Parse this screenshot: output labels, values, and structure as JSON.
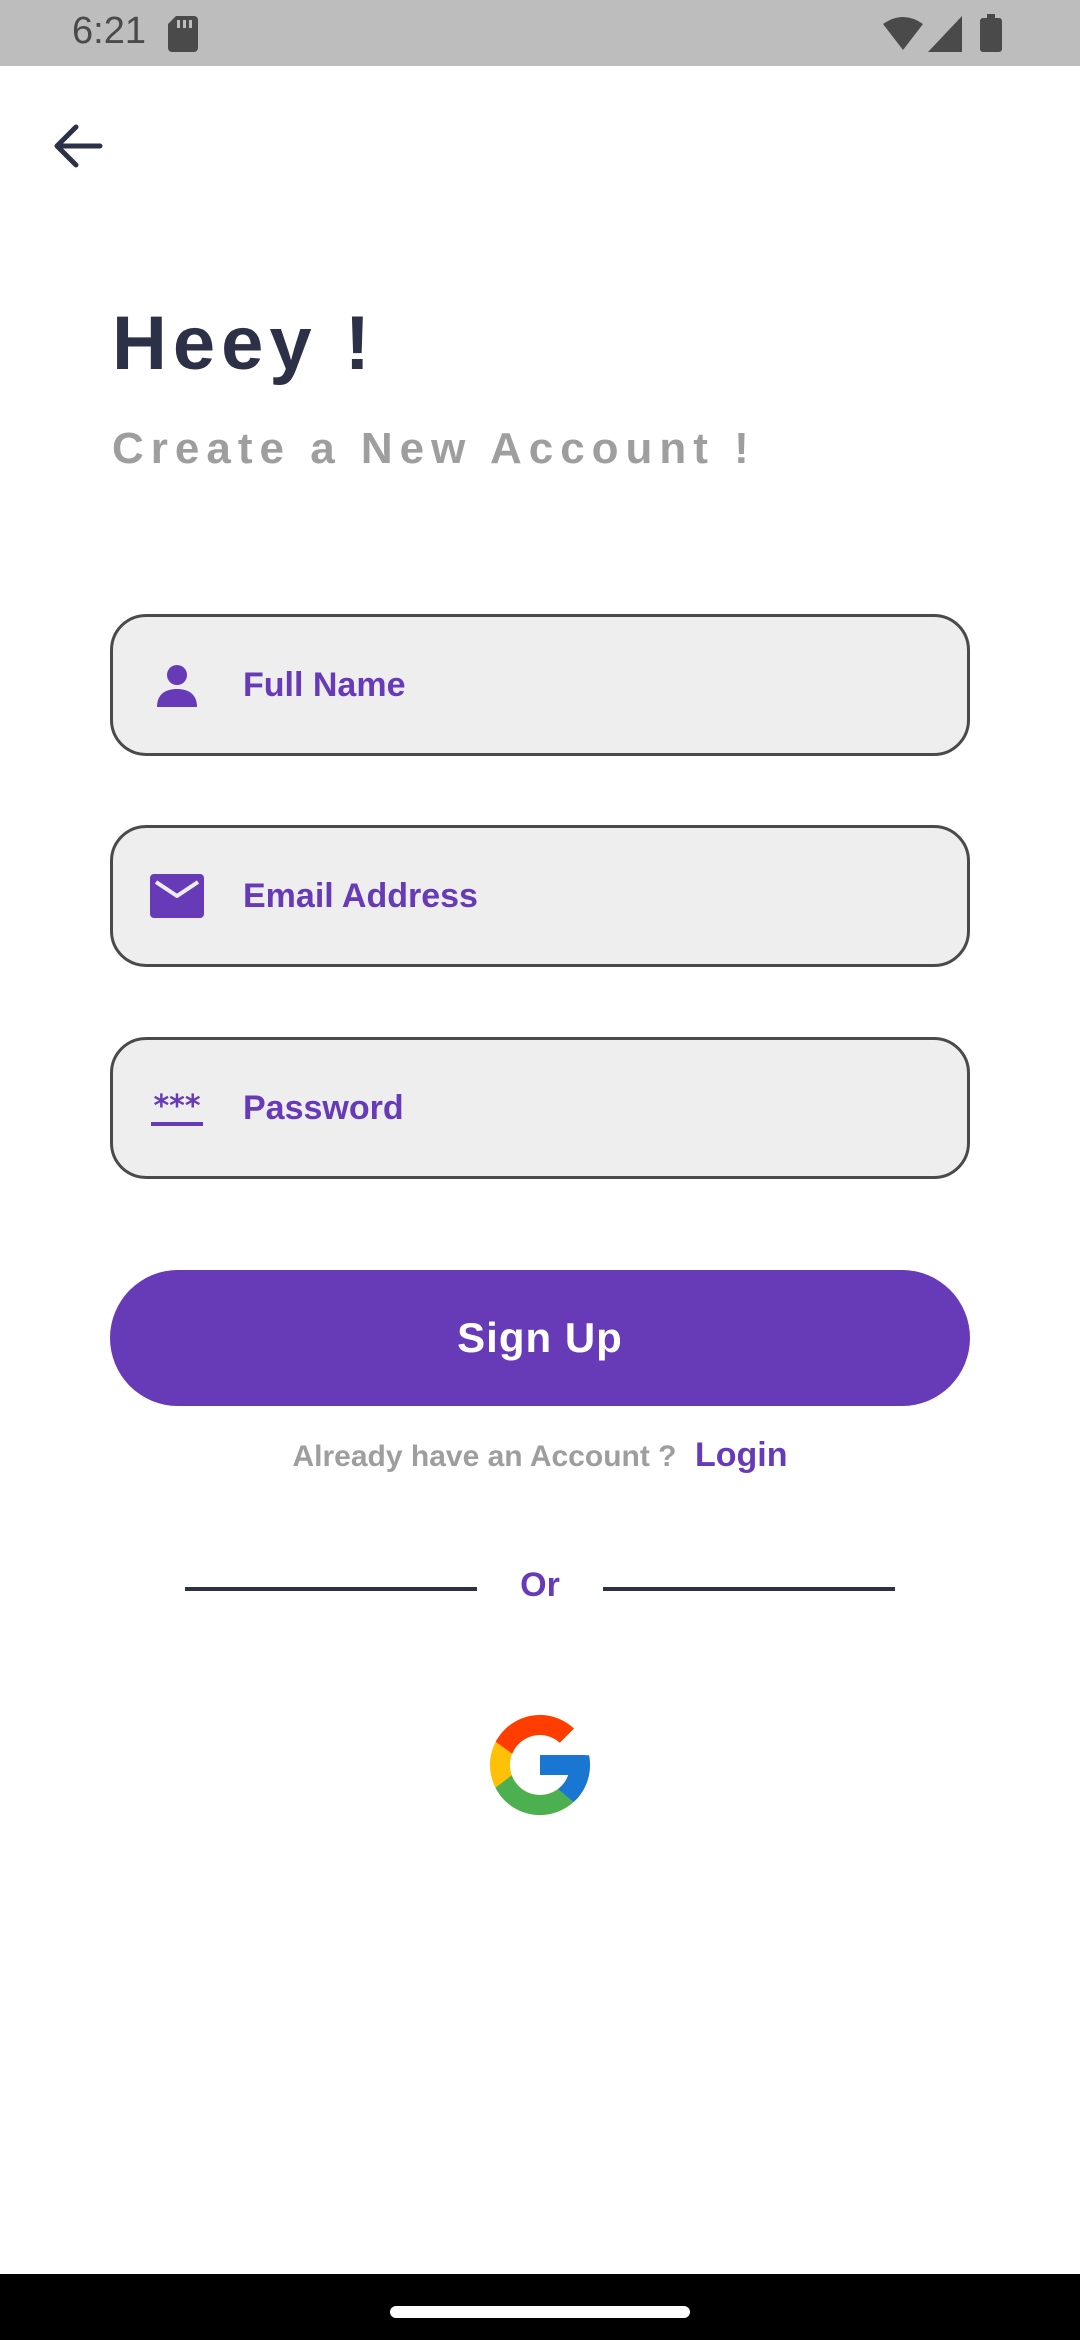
{
  "status_bar": {
    "time": "6:21",
    "icons": [
      "sd-card-icon",
      "wifi-icon",
      "cell-signal-icon",
      "battery-icon"
    ]
  },
  "header": {
    "back_icon": "arrow-left-icon"
  },
  "main": {
    "title": "Heey !",
    "subtitle": "Create a New Account !"
  },
  "form": {
    "full_name": {
      "placeholder": "Full Name",
      "value": "",
      "icon": "person-icon"
    },
    "email": {
      "placeholder": "Email Address",
      "value": "",
      "icon": "mail-icon"
    },
    "password": {
      "placeholder": "Password",
      "value": "",
      "icon": "password-dots-icon"
    }
  },
  "actions": {
    "signup_label": "Sign Up",
    "login_prompt": "Already have an Account ?",
    "login_label": "Login",
    "or_label": "Or",
    "google_icon": "google-logo-icon"
  },
  "colors": {
    "accent": "#673ab7",
    "title": "#2c3147",
    "subtitle": "#9e9e9e",
    "field_bg": "#eeeeee",
    "status_bar_bg": "#bdbdbd"
  }
}
